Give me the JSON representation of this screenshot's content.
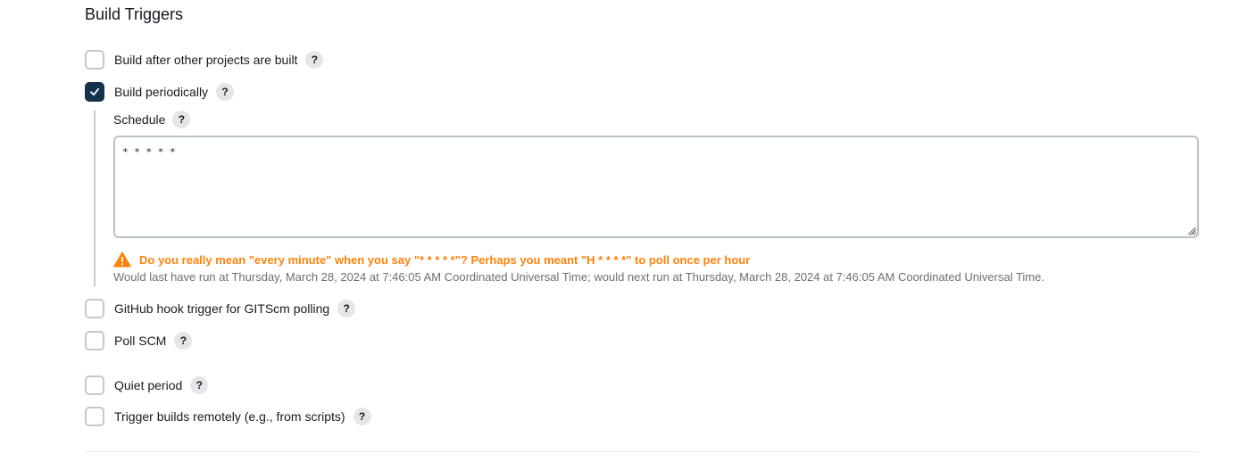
{
  "section": {
    "title": "Build Triggers"
  },
  "triggers": [
    {
      "label": "Build after other projects are built",
      "checked": false,
      "help": "?"
    },
    {
      "label": "Build periodically",
      "checked": true,
      "help": "?"
    },
    {
      "label": "GitHub hook trigger for GITScm polling",
      "checked": false,
      "help": "?"
    },
    {
      "label": "Poll SCM",
      "checked": false,
      "help": "?"
    },
    {
      "label": "Quiet period",
      "checked": false,
      "help": "?"
    },
    {
      "label": "Trigger builds remotely (e.g., from scripts)",
      "checked": false,
      "help": "?"
    }
  ],
  "schedule": {
    "label": "Schedule",
    "help": "?",
    "value": "* * * * *",
    "warning": "Do you really mean \"every minute\" when you say \"* * * * *\"? Perhaps you meant \"H * * * *\" to poll once per hour",
    "info": "Would last have run at Thursday, March 28, 2024 at 7:46:05 AM Coordinated Universal Time; would next run at Thursday, March 28, 2024 at 7:46:05 AM Coordinated Universal Time."
  },
  "colors": {
    "checked_fill": "#14324b",
    "warning": "#fe820a",
    "info": "#6b6f76"
  },
  "icons": {
    "check": "check-icon",
    "warning": "warning-triangle-icon",
    "help": "help-icon"
  }
}
